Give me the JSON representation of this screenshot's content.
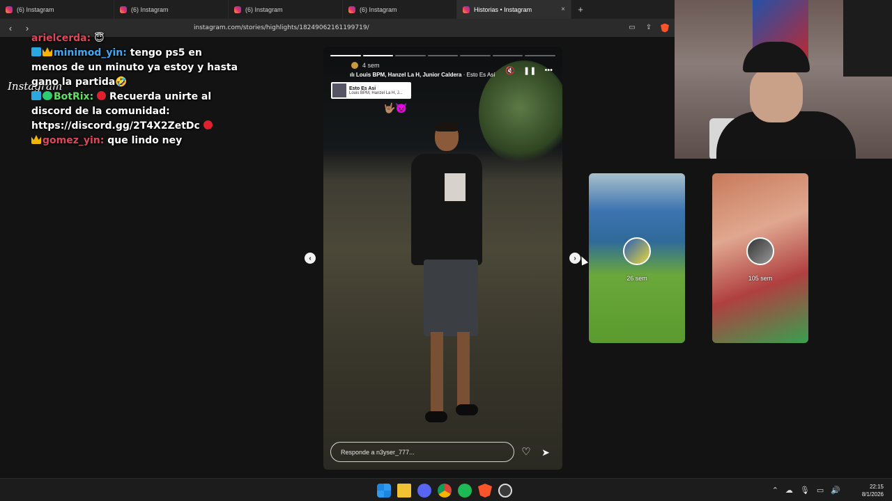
{
  "browser": {
    "tabs": [
      {
        "label": "(6) Instagram",
        "active": false
      },
      {
        "label": "(6) Instagram",
        "active": false
      },
      {
        "label": "(6) Instagram",
        "active": false
      },
      {
        "label": "(6) Instagram",
        "active": false
      },
      {
        "label": "Historias • Instagram",
        "active": true
      }
    ],
    "close_glyph": "×",
    "new_tab_glyph": "+",
    "url": "instagram.com/stories/highlights/18249062161199719/"
  },
  "instagram": {
    "logo": "Instagram"
  },
  "chat": [
    {
      "user": "arielcerda:",
      "message": "😇",
      "color": "#e0455a",
      "badges": []
    },
    {
      "user": "minimod_yin:",
      "message": "tengo ps5 en menos de un minuto ya estoy y hasta gano la partida🤣",
      "color": "#3fa9f5",
      "badges": [
        "sword-icon",
        "crown-icon"
      ]
    },
    {
      "user": "BotRix:",
      "message": "Recuerda unirte al discord de la comunidad: https://discord.gg/2T4X2ZetDc",
      "color": "#5fe05f",
      "badges": [
        "sword-icon",
        "verified-icon"
      ]
    },
    {
      "user": "gomez_yin:",
      "message": "que lindo ney",
      "color": "#e0455a",
      "badges": [
        "crown-icon"
      ]
    }
  ],
  "story": {
    "time": "4 sem",
    "music_artists": "Louis BPM, Hanzel La H, Junior Caldera",
    "music_song": "· Esto Es Así",
    "sticker_title": "Esto Es Asi",
    "sticker_subtitle": "Louis BPM, Hanzel La H, J...",
    "reply_placeholder": "Responde a n3yser_777...",
    "progress_total": 7,
    "progress_done": 2
  },
  "previews": [
    {
      "label": "26 sem"
    },
    {
      "label": "105 sem"
    }
  ],
  "taskbar": {
    "time": "22:15",
    "date": "8/1/2026"
  }
}
